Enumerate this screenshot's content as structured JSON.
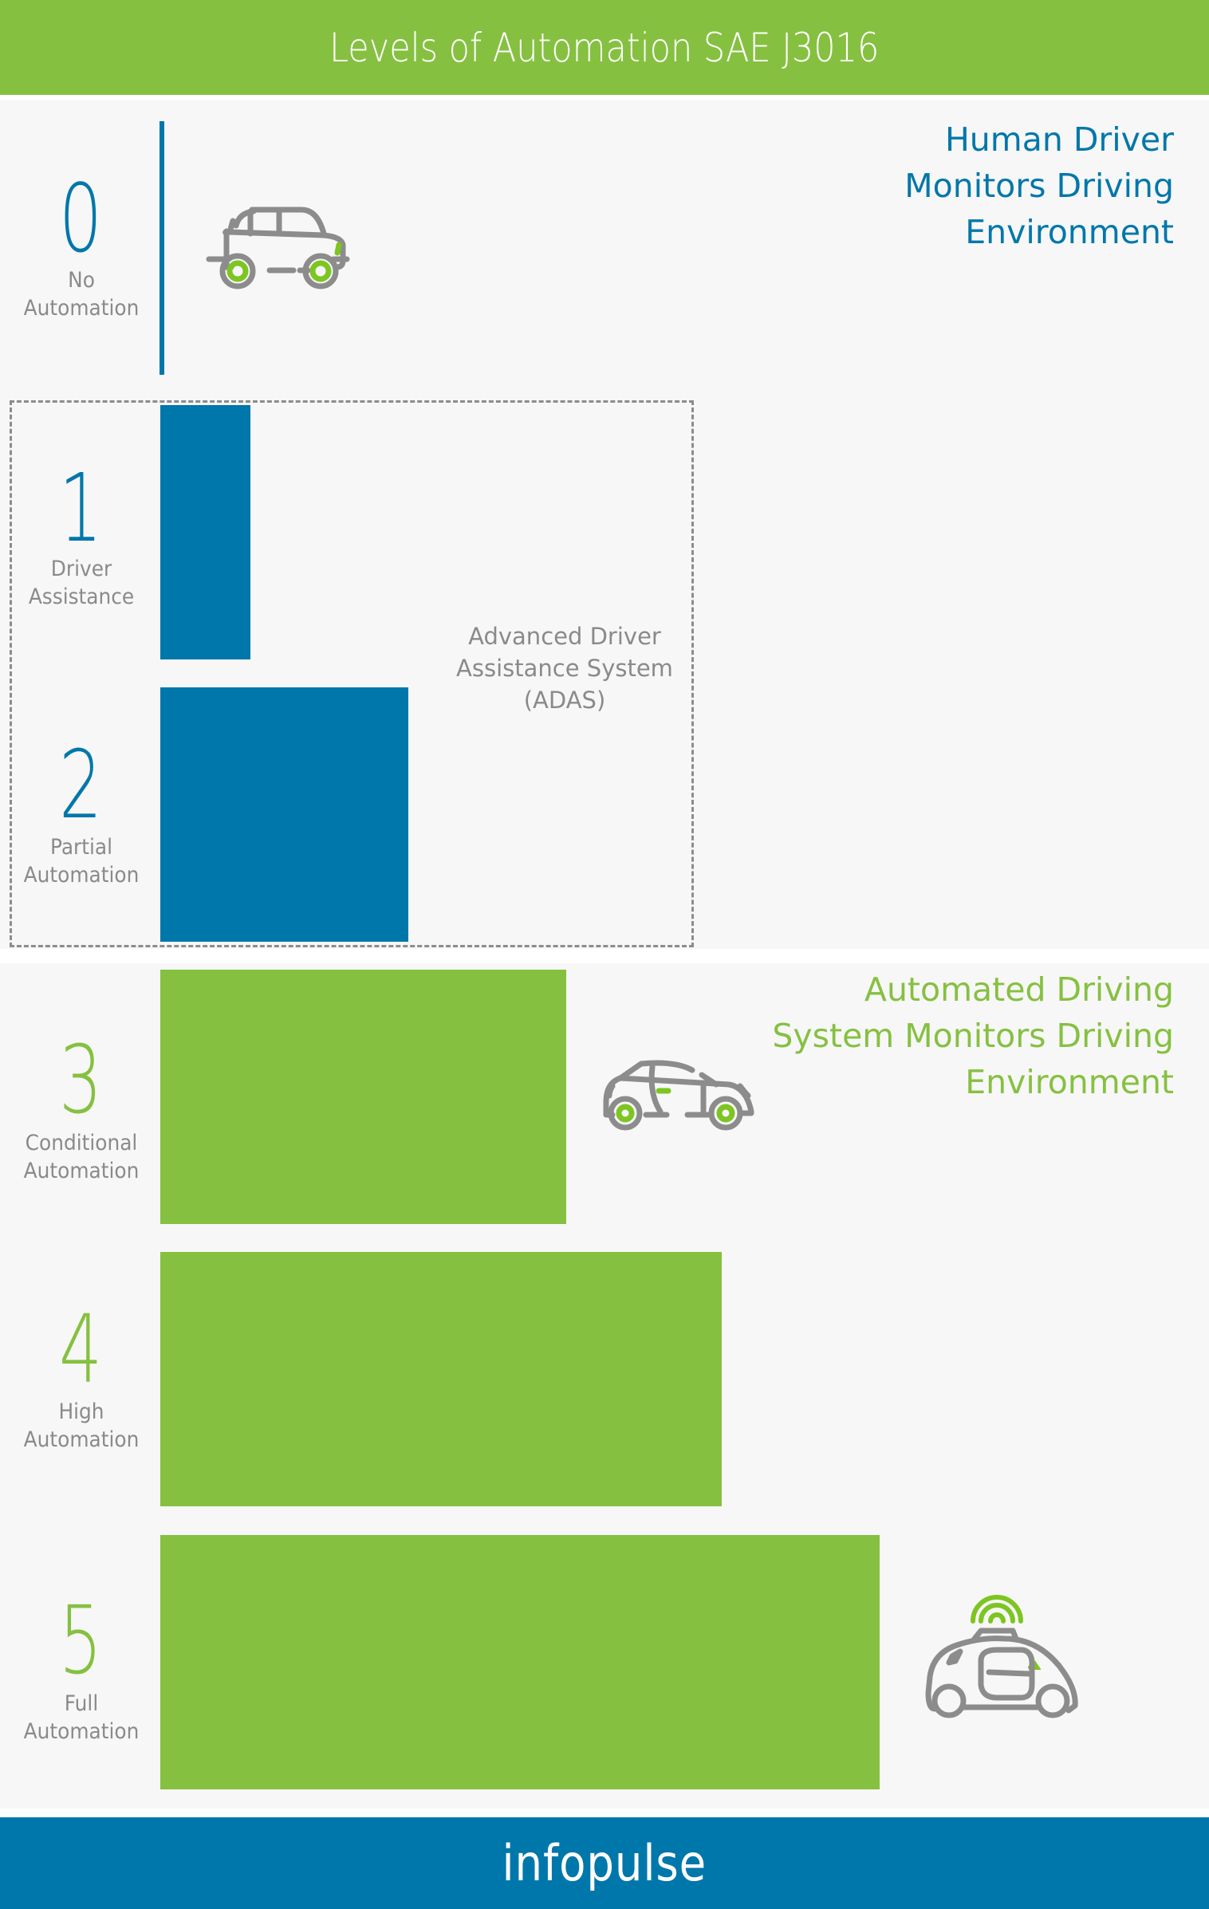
{
  "header": {
    "title": "Levels of Automation SAE J3016"
  },
  "headings": {
    "human": [
      "Human Driver",
      "Monitors Driving",
      "Environment"
    ],
    "system": [
      "Automated Driving",
      "System Monitors Driving",
      "Environment"
    ]
  },
  "adas": {
    "lines": [
      "Advanced Driver",
      "Assistance System",
      "(ADAS)"
    ]
  },
  "levels": [
    {
      "number": "0",
      "label_lines": [
        "No",
        "Automation"
      ],
      "color": "#0077aa"
    },
    {
      "number": "1",
      "label_lines": [
        "Driver",
        "Assistance"
      ],
      "color": "#0077aa"
    },
    {
      "number": "2",
      "label_lines": [
        "Partial",
        "Automation"
      ],
      "color": "#0077aa"
    },
    {
      "number": "3",
      "label_lines": [
        "Conditional",
        "Automation"
      ],
      "color": "#86c041"
    },
    {
      "number": "4",
      "label_lines": [
        "High",
        "Automation"
      ],
      "color": "#86c041"
    },
    {
      "number": "5",
      "label_lines": [
        "Full",
        "Automation"
      ],
      "color": "#86c041"
    }
  ],
  "icons": {
    "level0": "classic-car-icon",
    "level3": "hatchback-car-icon",
    "level5": "self-driving-car-icon"
  },
  "footer": {
    "logo": "infopulse"
  },
  "colors": {
    "blue": "#0077aa",
    "green": "#86c041",
    "grey": "#8a8a8a",
    "background": "#f7f7f7"
  },
  "chart_data": {
    "type": "bar",
    "orientation": "horizontal",
    "title": "Levels of Automation SAE J3016",
    "categories": [
      "No Automation",
      "Driver Assistance",
      "Partial Automation",
      "Conditional Automation",
      "High Automation",
      "Full Automation"
    ],
    "levels": [
      0,
      1,
      2,
      3,
      4,
      5
    ],
    "values": [
      0,
      1,
      2,
      3,
      4,
      5
    ],
    "xlim": [
      0,
      5
    ],
    "series_groups": [
      {
        "name": "Human Driver Monitors Driving Environment",
        "levels": [
          0,
          1,
          2
        ],
        "color": "#0077aa"
      },
      {
        "name": "Automated Driving System Monitors Driving Environment",
        "levels": [
          3,
          4,
          5
        ],
        "color": "#86c041"
      }
    ],
    "annotations": [
      {
        "text": "Advanced Driver Assistance System (ADAS)",
        "levels": [
          1,
          2
        ],
        "style": "dashed-box"
      }
    ],
    "grid": false,
    "legend": "none"
  }
}
